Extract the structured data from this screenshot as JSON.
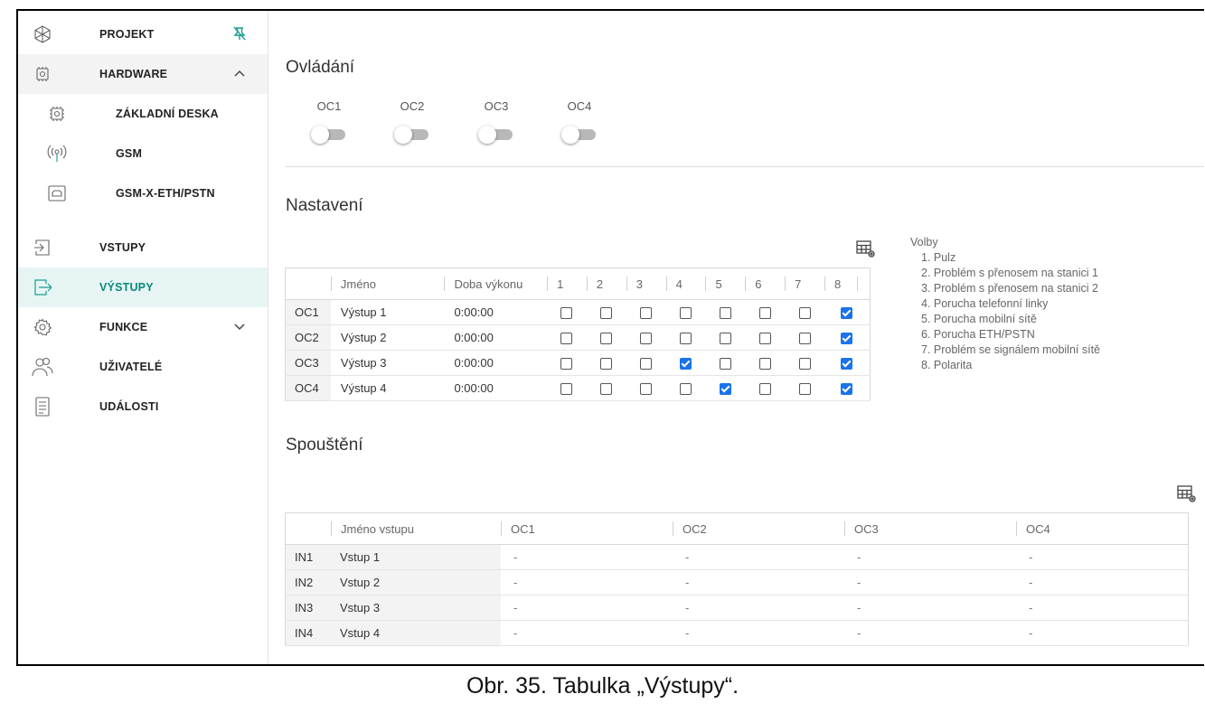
{
  "sidebar": {
    "items": [
      {
        "label": "PROJEKT",
        "icon": "snowflake-icon",
        "right_icon": "pin-icon"
      },
      {
        "label": "HARDWARE",
        "icon": "chip-icon",
        "right_icon": "chevron-up-icon"
      },
      {
        "label": "ZÁKLADNÍ DESKA",
        "icon": "chip-icon"
      },
      {
        "label": "GSM",
        "icon": "antenna-icon"
      },
      {
        "label": "GSM-X-ETH/PSTN",
        "icon": "ethernet-module-icon"
      },
      {
        "label": "VSTUPY",
        "icon": "input-icon"
      },
      {
        "label": "VÝSTUPY",
        "icon": "output-icon"
      },
      {
        "label": "FUNKCE",
        "icon": "gear-icon",
        "right_icon": "chevron-down-icon"
      },
      {
        "label": "UŽIVATELÉ",
        "icon": "users-icon"
      },
      {
        "label": "UDÁLOSTI",
        "icon": "document-icon"
      }
    ]
  },
  "ovladani": {
    "title": "Ovládání",
    "toggles": [
      {
        "label": "OC1",
        "on": false
      },
      {
        "label": "OC2",
        "on": false
      },
      {
        "label": "OC3",
        "on": false
      },
      {
        "label": "OC4",
        "on": false
      }
    ]
  },
  "nastaveni": {
    "title": "Nastavení",
    "headers": [
      "Jméno",
      "Doba výkonu",
      "1",
      "2",
      "3",
      "4",
      "5",
      "6",
      "7",
      "8"
    ],
    "rows": [
      {
        "id": "OC1",
        "name": "Výstup 1",
        "time": "0:00:00",
        "checks": [
          false,
          false,
          false,
          false,
          false,
          false,
          false,
          true
        ]
      },
      {
        "id": "OC2",
        "name": "Výstup 2",
        "time": "0:00:00",
        "checks": [
          false,
          false,
          false,
          false,
          false,
          false,
          false,
          true
        ]
      },
      {
        "id": "OC3",
        "name": "Výstup 3",
        "time": "0:00:00",
        "checks": [
          false,
          false,
          false,
          true,
          false,
          false,
          false,
          true
        ]
      },
      {
        "id": "OC4",
        "name": "Výstup 4",
        "time": "0:00:00",
        "checks": [
          false,
          false,
          false,
          false,
          true,
          false,
          false,
          true
        ]
      }
    ],
    "legend_title": "Volby",
    "legend": [
      "1. Pulz",
      "2. Problém s přenosem na stanici 1",
      "3. Problém s přenosem na stanici 2",
      "4. Porucha telefonní linky",
      "5. Porucha mobilní sítě",
      "6. Porucha ETH/PSTN",
      "7. Problém se signálem mobilní sítě",
      "8. Polarita"
    ]
  },
  "spousteni": {
    "title": "Spouštění",
    "headers": [
      "Jméno vstupu",
      "OC1",
      "OC2",
      "OC3",
      "OC4"
    ],
    "rows": [
      {
        "id": "IN1",
        "name": "Vstup 1",
        "values": [
          "-",
          "-",
          "-",
          "-"
        ]
      },
      {
        "id": "IN2",
        "name": "Vstup 2",
        "values": [
          "-",
          "-",
          "-",
          "-"
        ]
      },
      {
        "id": "IN3",
        "name": "Vstup 3",
        "values": [
          "-",
          "-",
          "-",
          "-"
        ]
      },
      {
        "id": "IN4",
        "name": "Vstup 4",
        "values": [
          "-",
          "-",
          "-",
          "-"
        ]
      }
    ]
  },
  "caption": "Obr. 35. Tabulka „Výstupy“."
}
